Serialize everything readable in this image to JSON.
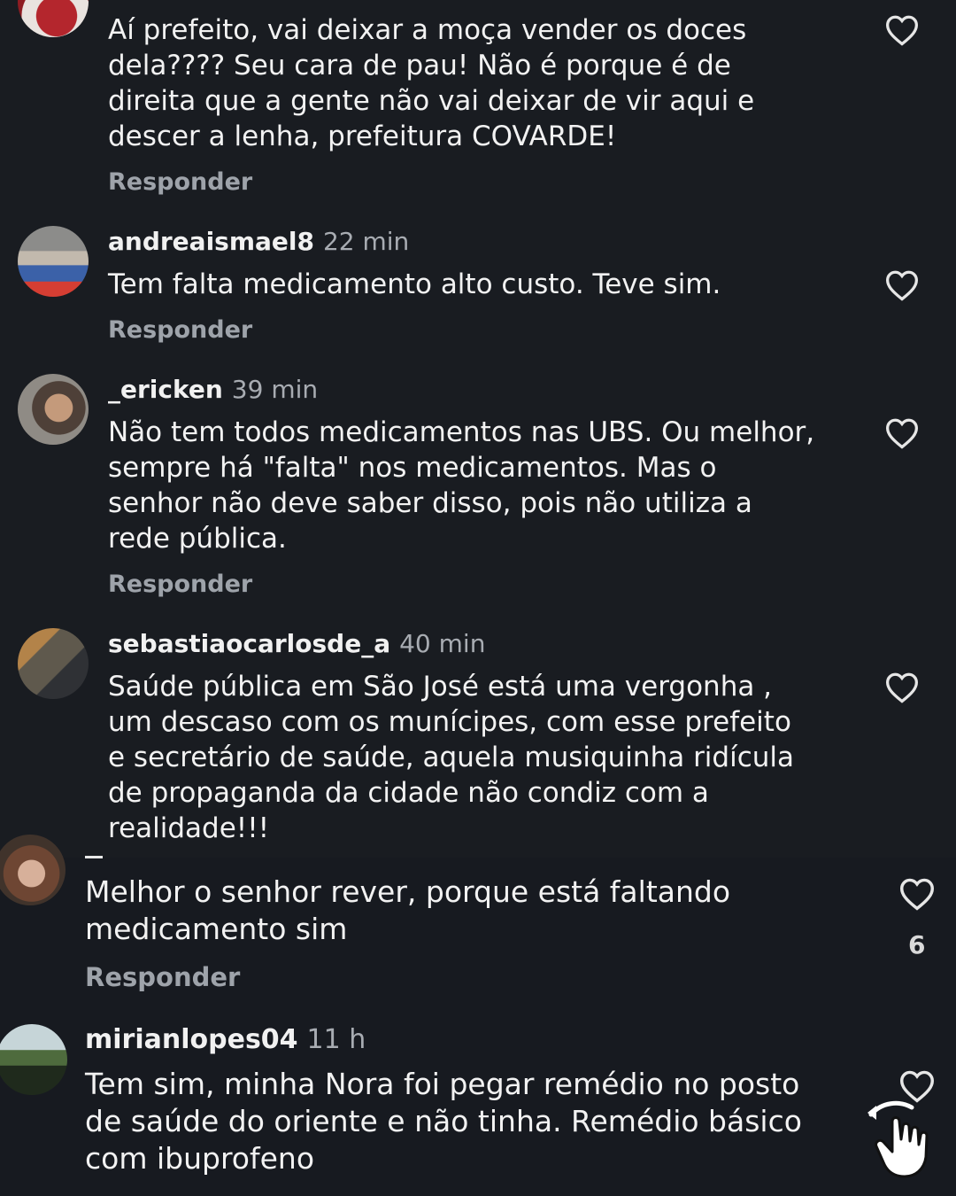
{
  "comments_top": [
    {
      "username": "",
      "time": "",
      "text": "Aí prefeito, vai deixar a moça vender os doces\ndela???? Seu cara de pau! Não é porque é de\ndireita que a gente não vai deixar de vir aqui e\ndescer a lenha, prefeitura COVARDE!",
      "reply_label": "Responder"
    },
    {
      "username": "andreaismael8",
      "time": "22 min",
      "text": "Tem falta medicamento alto custo. Teve sim.",
      "reply_label": "Responder"
    },
    {
      "username": "_ericken",
      "time": "39 min",
      "text": "Não tem todos medicamentos nas UBS. Ou melhor,\nsempre há \"falta\" nos medicamentos. Mas o\nsenhor não deve saber disso, pois não utiliza a\nrede pública.",
      "reply_label": "Responder"
    },
    {
      "username": "sebastiaocarlosde_a",
      "time": "40 min",
      "text": "Saúde pública em São José está uma vergonha ,\num descaso com os munícipes,  com esse prefeito\ne secretário de saúde,  aquela musiquinha ridícula\nde propaganda da cidade não condiz com a\nrealidade!!!"
    }
  ],
  "comments_bottom": [
    {
      "text": "Melhor o senhor rever, porque está faltando\nmedicamento sim",
      "likes": "6",
      "reply_label": "Responder"
    },
    {
      "username": "mirianlopes04",
      "time": "11 h",
      "text": "Tem sim, minha Nora foi pegar remédio no posto\nde saúde do oriente e não tinha. Remédio básico\ncom ibuprofeno"
    }
  ],
  "icons": {
    "like": "heart-outline-icon",
    "cursor": "hand-pointer-icon"
  },
  "colors": {
    "background": "#191c21",
    "text": "#f1f1f1",
    "muted": "#a8acb2"
  }
}
